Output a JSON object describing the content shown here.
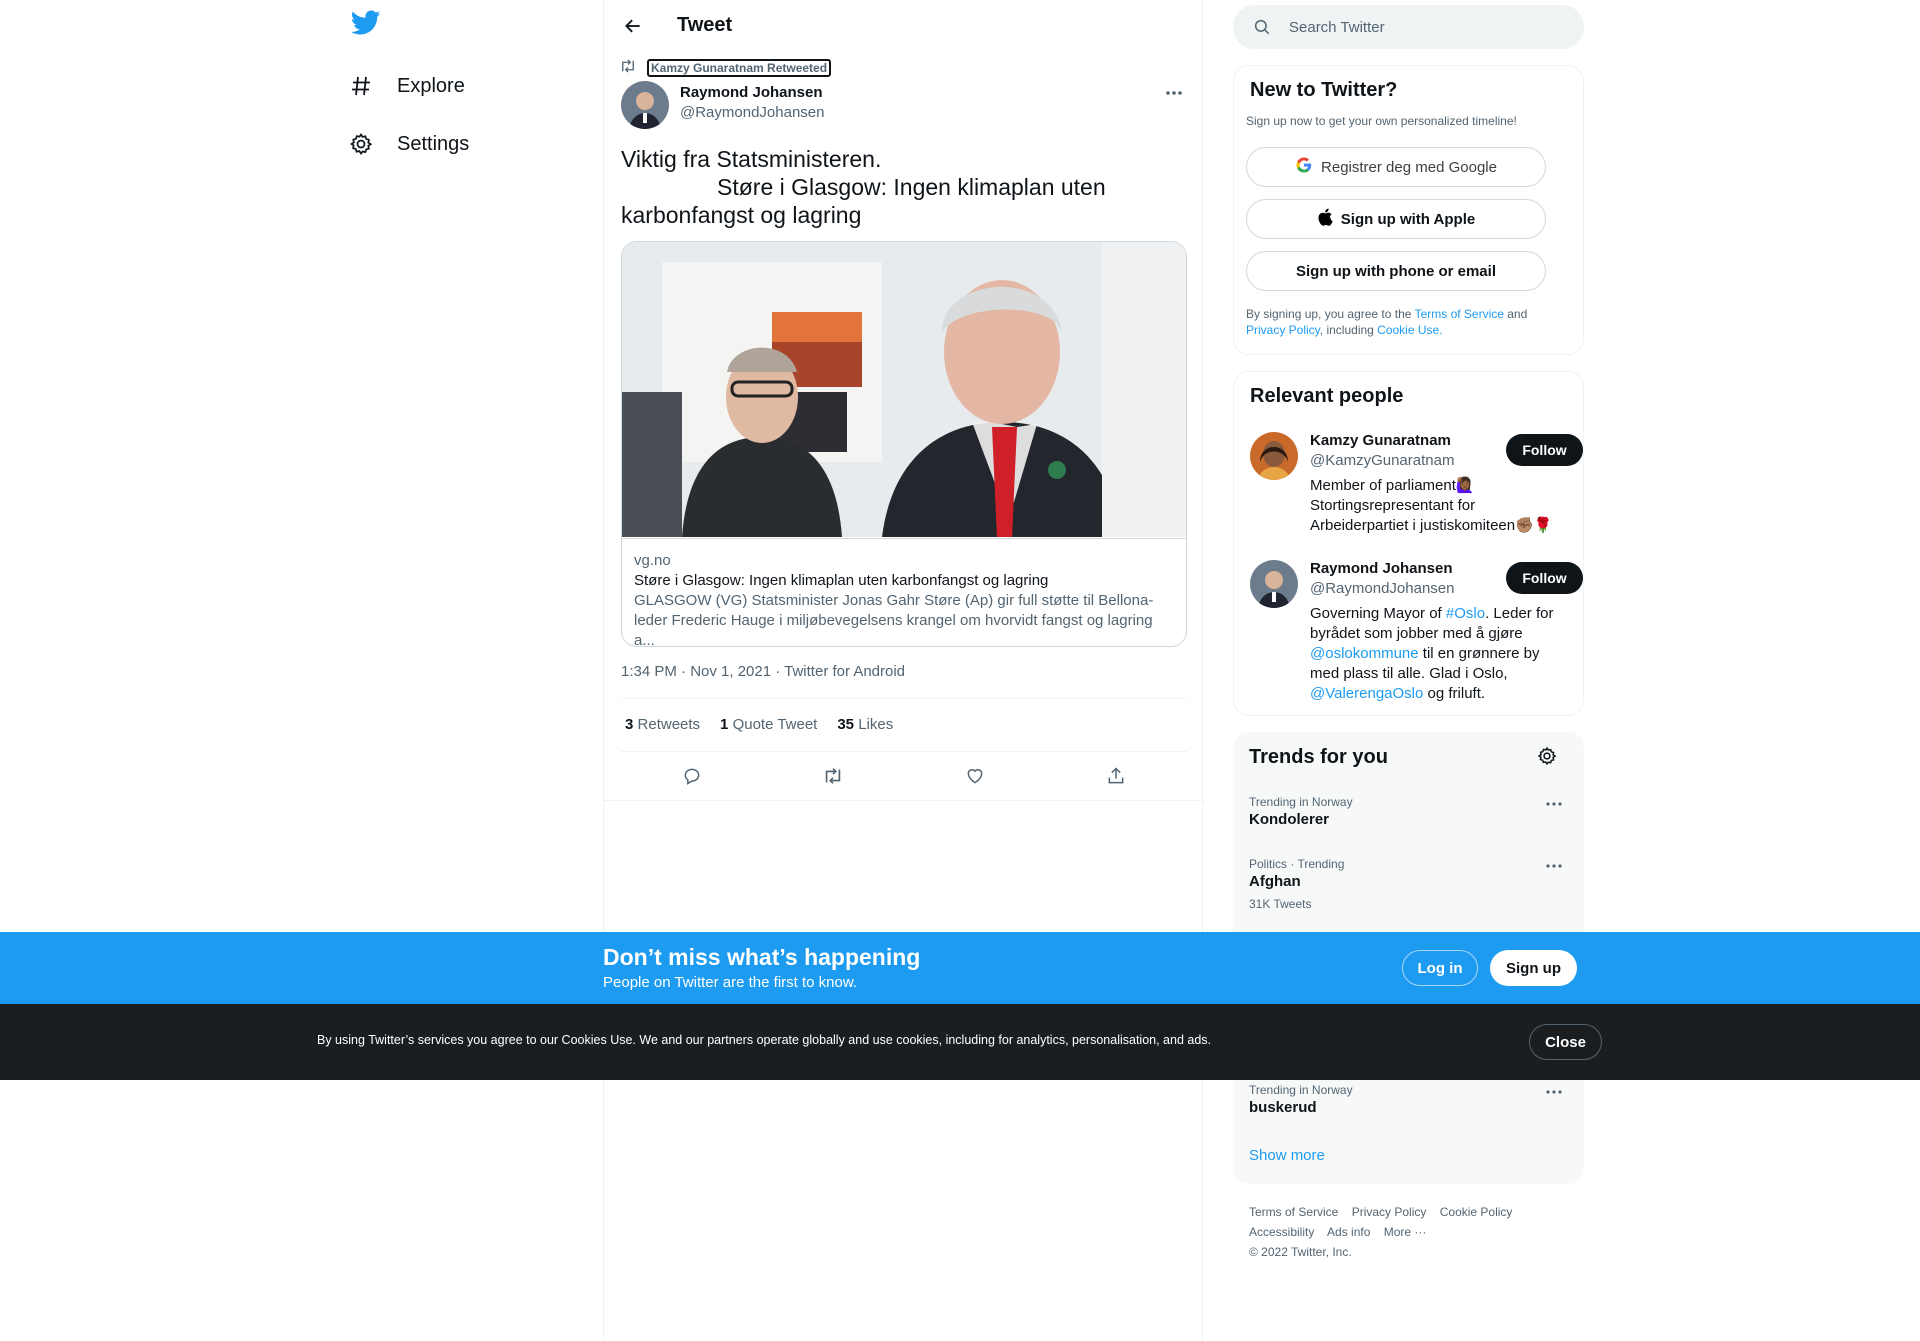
{
  "nav": {
    "explore_label": "Explore",
    "settings_label": "Settings"
  },
  "header": {
    "title": "Tweet"
  },
  "tweet": {
    "retweeted_by": "Kamzy Gunaratnam Retweeted",
    "author_name": "Raymond Johansen",
    "author_handle": "@RaymondJohansen",
    "text_line1": "Viktig fra Statsministeren.",
    "text_line2": "Støre i Glasgow: Ingen klimaplan uten",
    "text_line3": "karbonfangst og lagring",
    "card": {
      "domain": "vg.no",
      "title": "Støre i Glasgow: Ingen klimaplan uten karbonfangst og lagring",
      "desc_line1": "GLASGOW (VG) Statsminister Jonas Gahr Støre (Ap) gir full støtte til Bellona-",
      "desc_line2": "leder Frederic Hauge i miljøbevegelsens krangel om hvorvidt fangst og lagring a..."
    },
    "timestamp": "1:34 PM · Nov 1, 2021 · Twitter for Android",
    "stats": {
      "retweets_count": "3",
      "retweets_label": "Retweets",
      "quotes_count": "1",
      "quotes_label": "Quote Tweet",
      "likes_count": "35",
      "likes_label": "Likes"
    }
  },
  "search": {
    "placeholder": "Search Twitter"
  },
  "new_to_twitter": {
    "title": "New to Twitter?",
    "subtitle": "Sign up now to get your own personalized timeline!",
    "google_label": "Registrer deg med Google",
    "apple_label": "Sign up with Apple",
    "phone_label": "Sign up with phone or email",
    "legal_prefix": "By signing up, you agree to the ",
    "terms_link": "Terms of Service",
    "legal_and": " and",
    "privacy_link": "Privacy Policy",
    "legal_including": ", including ",
    "cookie_link": "Cookie Use."
  },
  "relevant_people": {
    "title": "Relevant people",
    "people": [
      {
        "name": "Kamzy Gunaratnam",
        "handle": "@KamzyGunaratnam",
        "bio": "Member of parliament🙋🏾‍♀️ Stortingsrepresentant for Arbeiderpartiet i justiskomiteen✊🏽🌹",
        "follow_label": "Follow"
      },
      {
        "name": "Raymond Johansen",
        "handle": "@RaymondJohansen",
        "bio_1": "Governing Mayor of ",
        "bio_link1": "#Oslo",
        "bio_2": ". Leder for byrådet som jobber med å gjøre ",
        "bio_link2": "@oslokommune",
        "bio_3": " til en grønnere by med plass til alle. Glad i Oslo, ",
        "bio_link3": "@ValerengaOslo",
        "bio_4": " og friluft.",
        "follow_label": "Follow"
      }
    ]
  },
  "trends": {
    "title": "Trends for you",
    "items": [
      {
        "context": "Trending in Norway",
        "name": "Kondolerer",
        "count": ""
      },
      {
        "context": "Politics · Trending",
        "name": "Afghan",
        "count": "31K Tweets"
      },
      {
        "context": "Trending in Norway",
        "name": "buskerud",
        "count": ""
      }
    ],
    "show_more": "Show more"
  },
  "footer": {
    "terms": "Terms of Service",
    "privacy": "Privacy Policy",
    "cookie": "Cookie Policy",
    "accessibility": "Accessibility",
    "ads": "Ads info",
    "more": "More ···",
    "copyright": "© 2022 Twitter, Inc."
  },
  "banner": {
    "title": "Don’t miss what’s happening",
    "subtitle": "People on Twitter are the first to know.",
    "login_label": "Log in",
    "signup_label": "Sign up"
  },
  "cookie_bar": {
    "text": "By using Twitter’s services you agree to our Cookies Use. We and our partners operate globally and use cookies, including for analytics, personalisation, and ads.",
    "close_label": "Close"
  },
  "colors": {
    "brand": "#1d9bf0",
    "text": "#0f1419",
    "muted": "#536471",
    "cookie_bg": "#1b1e21"
  }
}
